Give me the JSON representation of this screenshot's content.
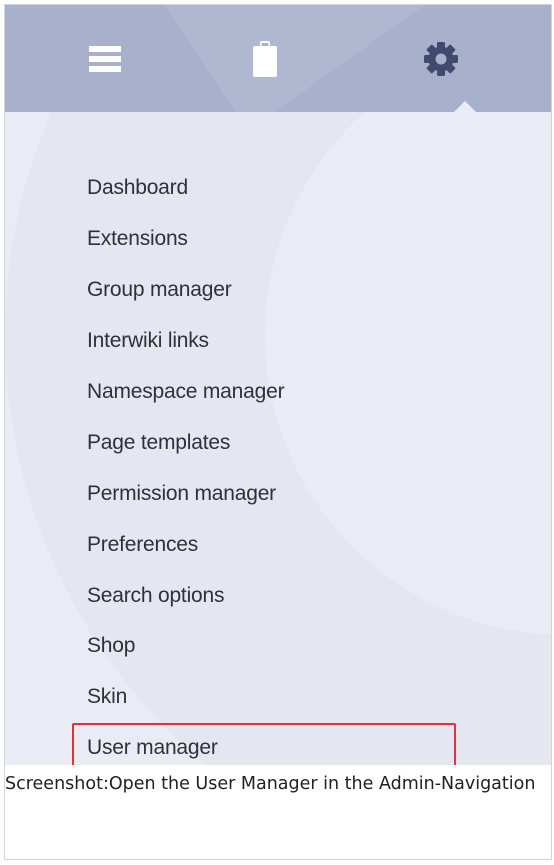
{
  "tabs": [
    {
      "icon": "menu-icon",
      "label": "Navigation"
    },
    {
      "icon": "clipboard-icon",
      "label": "Page tools"
    },
    {
      "icon": "gear-icon",
      "label": "Admin"
    }
  ],
  "active_tab": "Admin",
  "nav": {
    "items": [
      {
        "label": "Dashboard"
      },
      {
        "label": "Extensions"
      },
      {
        "label": "Group manager"
      },
      {
        "label": "Interwiki links"
      },
      {
        "label": "Namespace manager"
      },
      {
        "label": "Page templates"
      },
      {
        "label": "Permission manager"
      },
      {
        "label": "Preferences"
      },
      {
        "label": "Search options"
      },
      {
        "label": "Shop"
      },
      {
        "label": "Skin"
      },
      {
        "label": "User manager",
        "highlighted": true
      }
    ]
  },
  "caption": "Screenshot:Open the User Manager in the Admin-Navigation",
  "colors": {
    "tabbar": "#a8b0cc",
    "panel": "#e9ecf4",
    "icon": "#ffffff",
    "active_icon": "#3f4a6e",
    "highlight": "#e52f3a"
  }
}
